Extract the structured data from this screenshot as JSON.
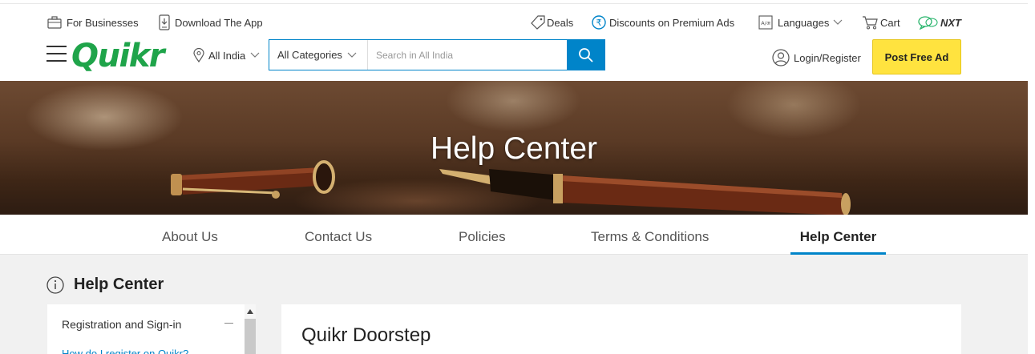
{
  "topbar": {
    "for_businesses": "For Businesses",
    "download_app": "Download The App",
    "deals": "Deals",
    "discounts": "Discounts on Premium Ads",
    "languages": "Languages",
    "cart": "Cart",
    "nxt": "NXT"
  },
  "logo": {
    "text": "Quikr",
    "color": "#1fa44a"
  },
  "location": {
    "label": "All India"
  },
  "search": {
    "category_value": "All Categories",
    "placeholder": "Search in All India",
    "accent": "#0084c9"
  },
  "account": {
    "login_label": "Login/Register"
  },
  "post_ad": {
    "label": "Post Free Ad",
    "color": "#ffe33f"
  },
  "banner": {
    "title": "Help Center"
  },
  "tabs": [
    {
      "label": "About Us"
    },
    {
      "label": "Contact Us"
    },
    {
      "label": "Policies"
    },
    {
      "label": "Terms & Conditions"
    },
    {
      "label": "Help Center",
      "active": true
    }
  ],
  "help": {
    "heading": "Help Center",
    "sidebar": {
      "section_label": "Registration and Sign-in",
      "sublink": "How do I register on Quikr?"
    },
    "panel_title": "Quikr Doorstep"
  }
}
